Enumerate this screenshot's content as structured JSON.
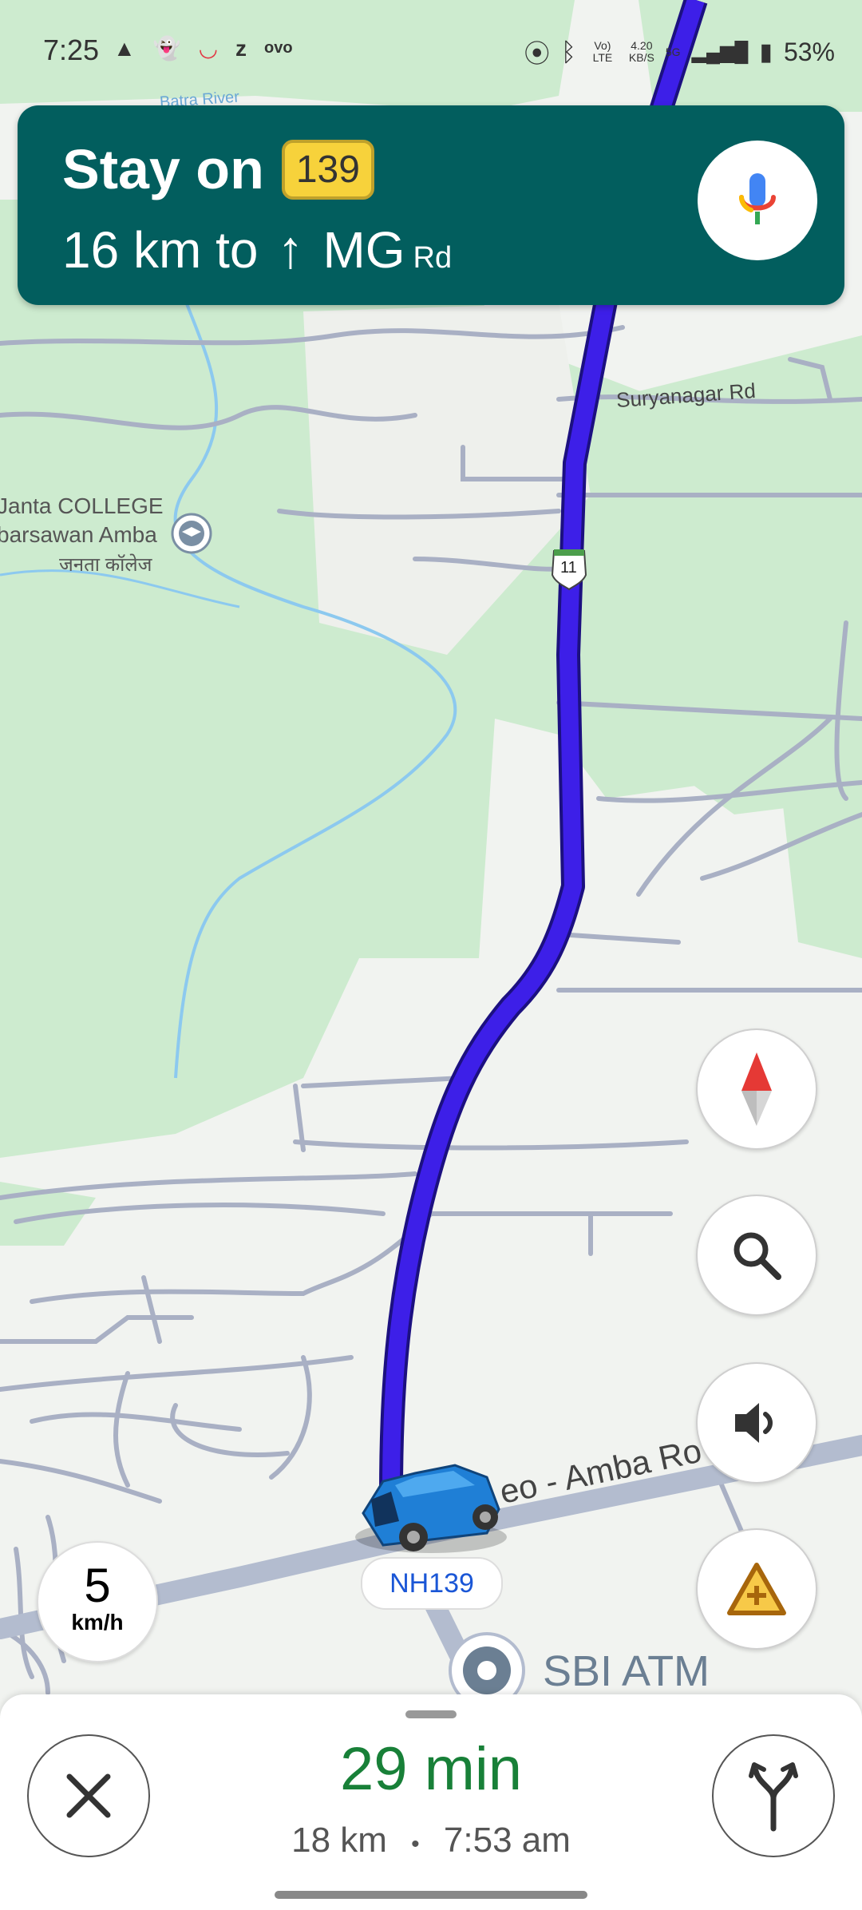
{
  "status_bar": {
    "time": "7:25",
    "network_top": "Vo) LTE",
    "speed_top": "4.20",
    "speed_bottom": "KB/S",
    "net_type": "5G",
    "battery": "53%"
  },
  "banner": {
    "prefix": "Stay on",
    "route_number": "139",
    "distance": "16 km to",
    "road": "MG",
    "road_suffix": "Rd"
  },
  "map_labels": {
    "river": "Batra River",
    "suryanagar": "Suryanagar Rd",
    "college_line1": "Janta COLLEGE",
    "college_line2": "barsawan Amba",
    "college_line3": "जनता कॉलेज",
    "highway_shield": "11",
    "road_name": "eo - Amba Ro",
    "poi": "SBI ATM",
    "current_road": "NH139"
  },
  "speed": {
    "value": "5",
    "unit": "km/h"
  },
  "trip": {
    "eta": "29 min",
    "distance": "18 km",
    "separator": "•",
    "arrival": "7:53 am"
  },
  "icons": {
    "mic": "mic-icon",
    "compass": "compass-icon",
    "search": "search-icon",
    "sound": "sound-icon",
    "report": "report-incident-icon",
    "close": "close-icon",
    "alternate": "alternate-route-icon"
  },
  "colors": {
    "banner": "#025e5e",
    "route": "#3d1fe8",
    "eta": "#188038",
    "park": "#cdebcf",
    "shield": "#f7d23b"
  }
}
